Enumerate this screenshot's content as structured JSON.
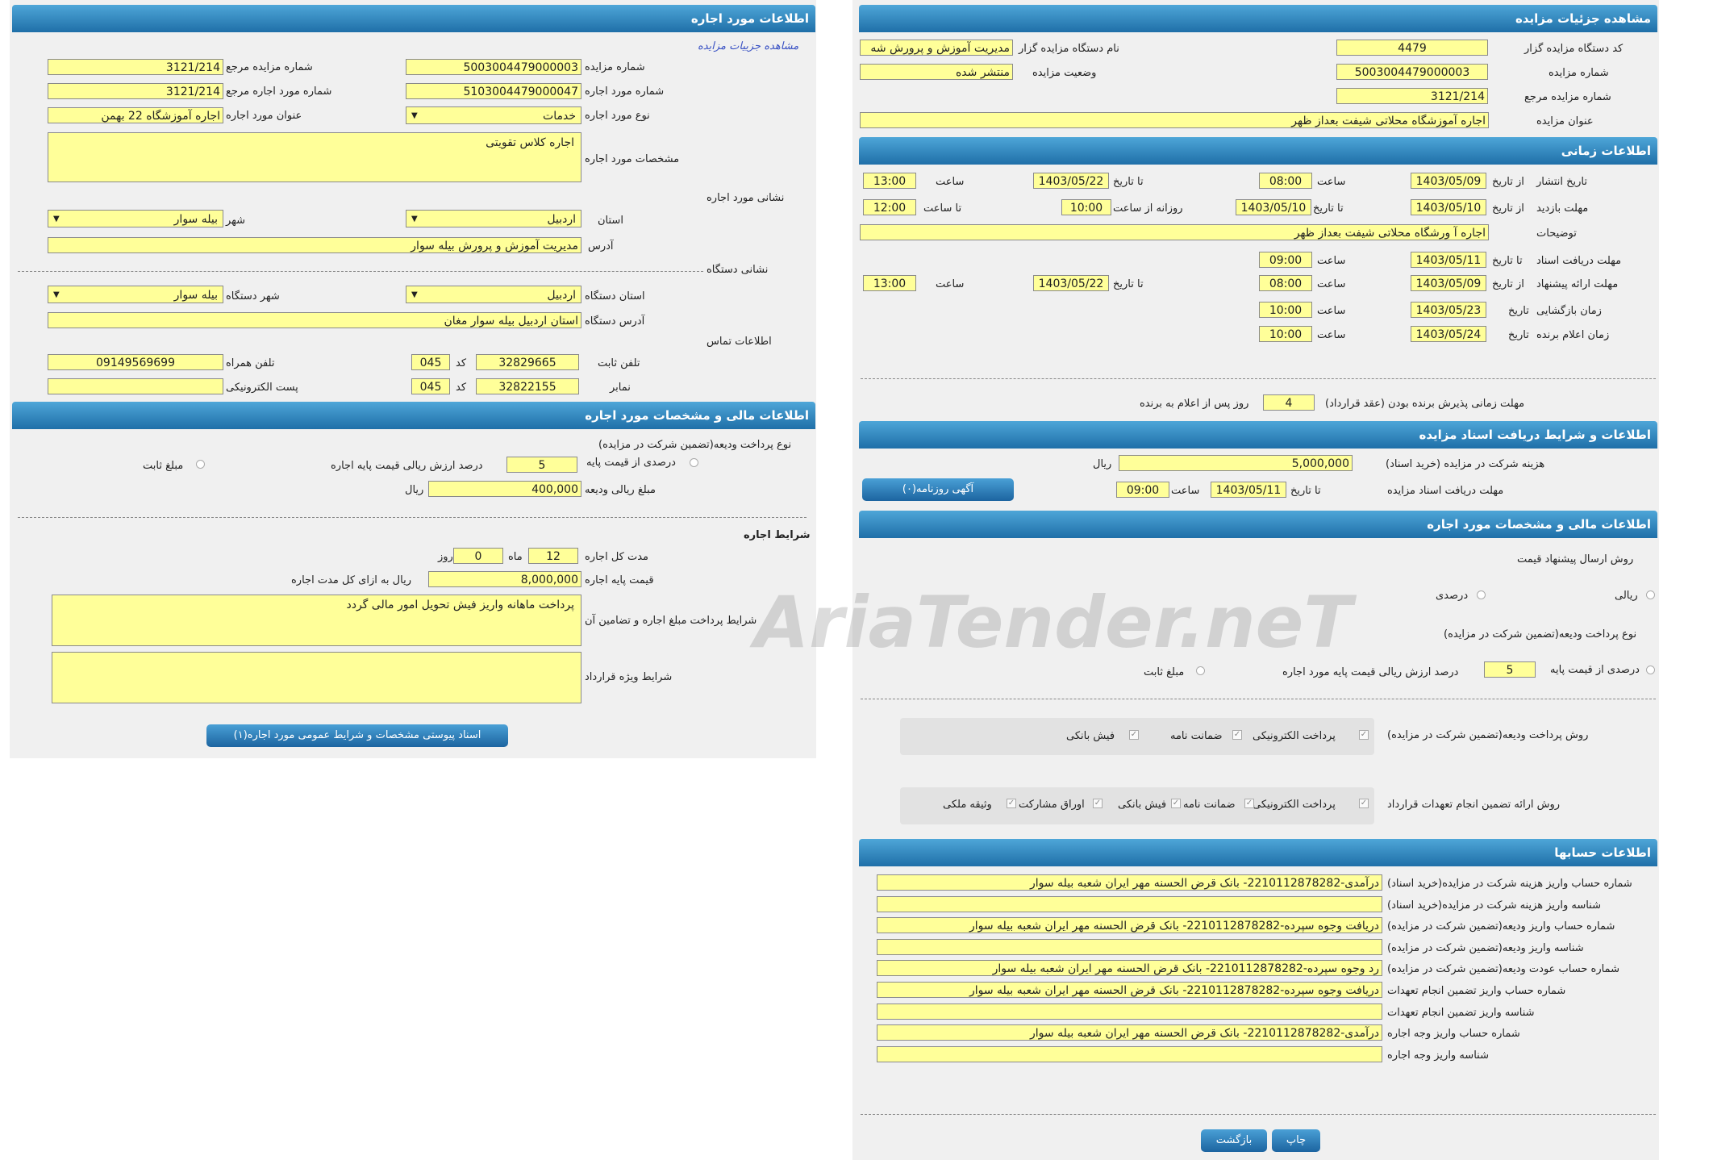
{
  "left": {
    "title": "اطلاعات مورد اجاره",
    "view_link": "مشاهده جزییات مزایده",
    "fields": {
      "auction_no_label": "شماره مزایده",
      "auction_no": "5003004479000003",
      "ref_auction_no_label": "شماره مزایده مرجع",
      "ref_auction_no": "3121/214",
      "rental_no_label": "شماره مورد اجاره",
      "rental_no": "5103004479000047",
      "ref_rental_no_label": "شماره مورد اجاره مرجع",
      "ref_rental_no": "3121/214",
      "rental_type_label": "نوع مورد اجاره",
      "rental_type": "خدمات",
      "rental_title_label": "عنوان مورد اجاره",
      "rental_title": "اجاره   آموزشگاه 22 بهمن",
      "spec_label": "مشخصات مورد اجاره",
      "spec": "اجاره کلاس  تقویتی"
    },
    "address_section": "نشانی مورد اجاره",
    "address": {
      "province_label": "استان",
      "province": "اردبیل",
      "city_label": "شهر",
      "city": "بیله سوار",
      "addr_label": "آدرس",
      "addr": "مدیریت  آموزش و پرورش  بیله سوار"
    },
    "org_section": "نشانی دستگاه",
    "org": {
      "province_label": "استان دستگاه",
      "province": "اردبیل",
      "city_label": "شهر دستگاه",
      "city": "بیله سوار",
      "addr_label": "آدرس دستگاه",
      "addr": "استان اردبیل بیله سوار مغان"
    },
    "contact_section": "اطلاعات تماس",
    "contact": {
      "phone_label": "تلفن ثابت",
      "phone": "32829665",
      "code_label": "کد",
      "phone_code": "045",
      "mobile_label": "تلفن همراه",
      "mobile": "09149569699",
      "fax_label": "نمابر",
      "fax": "32822155",
      "fax_code": "045",
      "email_label": "پست الکترونیکی",
      "email": ""
    },
    "finance_title": "اطلاعات مالی و مشخصات مورد اجاره",
    "finance": {
      "deposit_method_label": "نوع پرداخت ودیعه(تضمین شرکت در مزایده)",
      "percent_label": "درصدی از قیمت پایه",
      "percent_value": "5",
      "percent_suffix": "درصد ارزش ریالی قیمت پایه اجاره",
      "fixed_label": "مبلغ ثابت",
      "deposit_amount_label": "مبلغ ریالی ودیعه",
      "deposit_amount": "400,000",
      "rial": "ریال"
    },
    "rent_title": "شرایط اجاره",
    "rent": {
      "duration_label": "مدت کل اجاره",
      "months": "12",
      "month_label": "ماه",
      "days": "0",
      "day_label": "روز",
      "base_price_label": "قیمت پایه اجاره",
      "base_price": "8,000,000",
      "base_price_suffix": "ریال به ازای کل مدت اجاره",
      "payment_terms_label": "شرایط پرداخت مبلغ اجاره و تضامین آن",
      "payment_terms": "پرداخت ماهانه واریز  فیش تحویل امور مالی  گردد",
      "special_terms_label": "شرایط ویژه قرارداد",
      "special_terms": ""
    },
    "attach_button": "اسناد پیوستی مشخصات و شرایط عمومی مورد اجاره(۱)"
  },
  "right": {
    "title": "مشاهده جزئیات مزایده",
    "org_code_label": "کد دستگاه مزایده گزار",
    "org_code": "4479",
    "org_name_label": "نام دستگاه مزایده گزار",
    "org_name": "مدیریت آموزش و پرورش شه",
    "auction_no_label": "شماره مزایده",
    "auction_no": "5003004479000003",
    "status_label": "وضعیت مزایده",
    "status": "منتشر شده",
    "ref_no_label": "شماره مزایده مرجع",
    "ref_no": "3121/214",
    "auction_title_label": "عنوان مزایده",
    "auction_title": "اجاره آموزشگاه  محلاتی  شیفت بعداز ظهر",
    "time_title": "اطلاعات زمانی",
    "time": {
      "publish_label": "تاریخ انتشار",
      "from_date": "از تاریخ",
      "to_date": "تا تاریخ",
      "hour": "ساعت",
      "to_hour": "تا ساعت",
      "daily_from": "روزانه از ساعت",
      "publish_from": "1403/05/09",
      "publish_from_time": "08:00",
      "publish_to": "1403/05/22",
      "publish_to_time": "13:00",
      "visit_label": "مهلت بازدید",
      "visit_from": "1403/05/10",
      "visit_to": "1403/05/10",
      "visit_daily_from": "10:00",
      "visit_to_time": "12:00",
      "desc_label": "توضیحات",
      "desc": "اجاره آ ورشگاه محلاتی شیفت بعداز ظهر",
      "doc_deadline_label": "مهلت دریافت اسناد",
      "doc_to": "1403/05/11",
      "doc_to_time": "09:00",
      "offer_label": "مهلت ارائه پیشنهاد",
      "offer_from": "1403/05/09",
      "offer_from_time": "08:00",
      "offer_to": "1403/05/22",
      "offer_to_time": "13:00",
      "opening_label": "زمان بازگشایی",
      "date_label": "تاریخ",
      "opening_date": "1403/05/23",
      "opening_time": "10:00",
      "winner_label": "زمان اعلام برنده",
      "winner_date": "1403/05/24",
      "winner_time": "10:00",
      "accept_label": "مهلت زمانی پذیرش برنده بودن (عقد قرارداد)",
      "accept_days": "4",
      "accept_suffix": "روز پس از اعلام به برنده"
    },
    "docs_title": "اطلاعات و شرایط دریافت اسناد مزایده",
    "docs": {
      "fee_label": "هزینه شرکت در مزایده (خرید اسناد)",
      "fee": "5,000,000",
      "rial": "ریال",
      "deadline_label": "مهلت دریافت اسناد مزایده",
      "to_date": "تا تاریخ",
      "deadline_date": "1403/05/11",
      "hour": "ساعت",
      "deadline_time": "09:00",
      "news_button": "آگهی روزنامه(۰)"
    },
    "finance_title": "اطلاعات مالی و مشخصات مورد اجاره",
    "finance": {
      "offer_method_label": "روش ارسال پیشنهاد قیمت",
      "rial_opt": "ریالی",
      "percent_opt": "درصدی",
      "deposit_type_label": "نوع پرداخت ودیعه(تضمین شرکت در مزایده)",
      "percent_base_label": "درصدی از قیمت پایه",
      "percent_value": "5",
      "percent_suffix": "درصد ارزش ریالی قیمت پایه مورد اجاره",
      "fixed_label": "مبلغ ثابت",
      "deposit_pay_label": "روش پرداخت ودیعه(تضمین شرکت در مزایده)",
      "deposit_pay_opts": [
        "پرداخت الکترونیکی",
        "ضمانت نامه",
        "فیش بانکی"
      ],
      "guarantee_label": "روش ارائه تضمین انجام تعهدات قرارداد",
      "guarantee_opts": [
        "پرداخت الکترونیکی",
        "ضمانت نامه",
        "فیش بانکی",
        "اوراق مشارکت",
        "وثیقه ملکی"
      ]
    },
    "accounts_title": "اطلاعات حسابها",
    "accounts": [
      {
        "label": "شماره حساب واریز هزینه شرکت در مزایده(خرید اسناد)",
        "value": "درآمدی-2210112878282- بانک قرض الحسنه مهر ایران شعبه بیله سوار"
      },
      {
        "label": "شناسه واریز هزینه شرکت در مزایده(خرید اسناد)",
        "value": ""
      },
      {
        "label": "شماره حساب واریز ودیعه(تضمین شرکت در مزایده)",
        "value": "دریافت وجوه سپرده-2210112878282- بانک قرض الحسنه مهر ایران شعبه بیله سوار"
      },
      {
        "label": "شناسه واریز ودیعه(تضمین شرکت در مزایده)",
        "value": ""
      },
      {
        "label": "شماره حساب عودت ودیعه(تضمین شرکت در مزایده)",
        "value": "رد وجوه سپرده-2210112878282- بانک قرض الحسنه مهر ایران شعبه بیله سوار"
      },
      {
        "label": "شماره حساب واریز تضمین انجام تعهدات",
        "value": "دریافت وجوه سپرده-2210112878282- بانک قرض الحسنه مهر ایران شعبه بیله سوار"
      },
      {
        "label": "شناسه واریز تضمین انجام تعهدات",
        "value": ""
      },
      {
        "label": "شماره حساب واریز وجه اجاره",
        "value": "درآمدی-2210112878282- بانک قرض الحسنه مهر ایران شعبه بیله سوار"
      },
      {
        "label": "شناسه واریز وجه اجاره",
        "value": ""
      }
    ],
    "print_button": "چاپ",
    "back_button": "بازگشت"
  },
  "watermark": "AriaTender.neT"
}
